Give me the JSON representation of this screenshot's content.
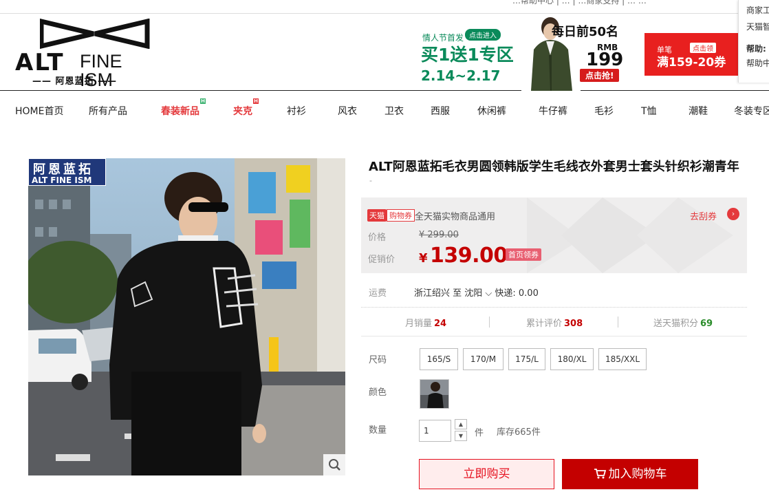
{
  "topbar": {
    "links_text": "…帮助中心 | …  | …商家支持 | …  …"
  },
  "header": {
    "logo_en_bold": "ALT",
    "logo_en_light": "FINE ISM",
    "logo_cn": "—— 阿恩蓝拓 ——"
  },
  "banner": {
    "sub_label": "情人节首发",
    "enter_button": "点击进入",
    "main_text": "买1送1专区",
    "date_range": "2.14~2.17",
    "daily_text": "每日前50名",
    "currency": "RMB",
    "price": "199",
    "grab_button": "点击抢!"
  },
  "coupon_banner": {
    "line1": "单笔",
    "claim": "点击领",
    "line2": "满159-20券"
  },
  "side_popup": {
    "items": [
      "商家工",
      "天猫智",
      "帮助:",
      "帮助中"
    ]
  },
  "nav": {
    "items": [
      {
        "label": "HOME首页",
        "highlight": false
      },
      {
        "label": "所有产品",
        "highlight": false
      },
      {
        "label": "春装新品",
        "highlight": true,
        "badge_color": "#3cb371"
      },
      {
        "label": "夹克",
        "highlight": true,
        "badge_color": "#e4393c"
      },
      {
        "label": "衬衫",
        "highlight": false
      },
      {
        "label": "风衣",
        "highlight": false
      },
      {
        "label": "卫衣",
        "highlight": false
      },
      {
        "label": "西服",
        "highlight": false
      },
      {
        "label": "休闲裤",
        "highlight": false
      },
      {
        "label": "牛仔裤",
        "highlight": false
      },
      {
        "label": "毛衫",
        "highlight": false
      },
      {
        "label": "T恤",
        "highlight": false
      },
      {
        "label": "潮鞋",
        "highlight": false
      },
      {
        "label": "冬装专区",
        "highlight": false
      }
    ]
  },
  "product_image": {
    "brand_cn": "阿恩蓝拓",
    "brand_en": "ALT FINE ISM"
  },
  "product": {
    "title": "ALT阿恩蓝拓毛衣男圆领韩版学生毛线衣外套男士套头针织衫潮青年",
    "subtitle": "-"
  },
  "price": {
    "tmall_tag": "天猫",
    "coupon_tag": "购物券",
    "coupon_desc": "全天猫实物商品通用",
    "go_coupon": "去刮券",
    "price_label": "价格",
    "original_price": "¥ 299.00",
    "promo_label": "促销价",
    "currency_symbol": "¥",
    "current_price": "139.00",
    "home_coupon": "首页领券"
  },
  "shipping": {
    "label": "运费",
    "value": "浙江绍兴  至 沈阳 ⌵ 快递: 0.00"
  },
  "stats": {
    "monthly_label": "月销量",
    "monthly_value": "24",
    "reviews_label": "累计评价",
    "reviews_value": "308",
    "points_label": "送天猫积分",
    "points_value": "69"
  },
  "options": {
    "size_label": "尺码",
    "sizes": [
      "165/S",
      "170/M",
      "175/L",
      "180/XL",
      "185/XXL"
    ],
    "color_label": "颜色",
    "qty_label": "数量",
    "qty_value": "1",
    "unit": "件",
    "stock": "库存665件"
  },
  "actions": {
    "buy_now": "立即购买",
    "add_to_cart": "加入购物车"
  }
}
